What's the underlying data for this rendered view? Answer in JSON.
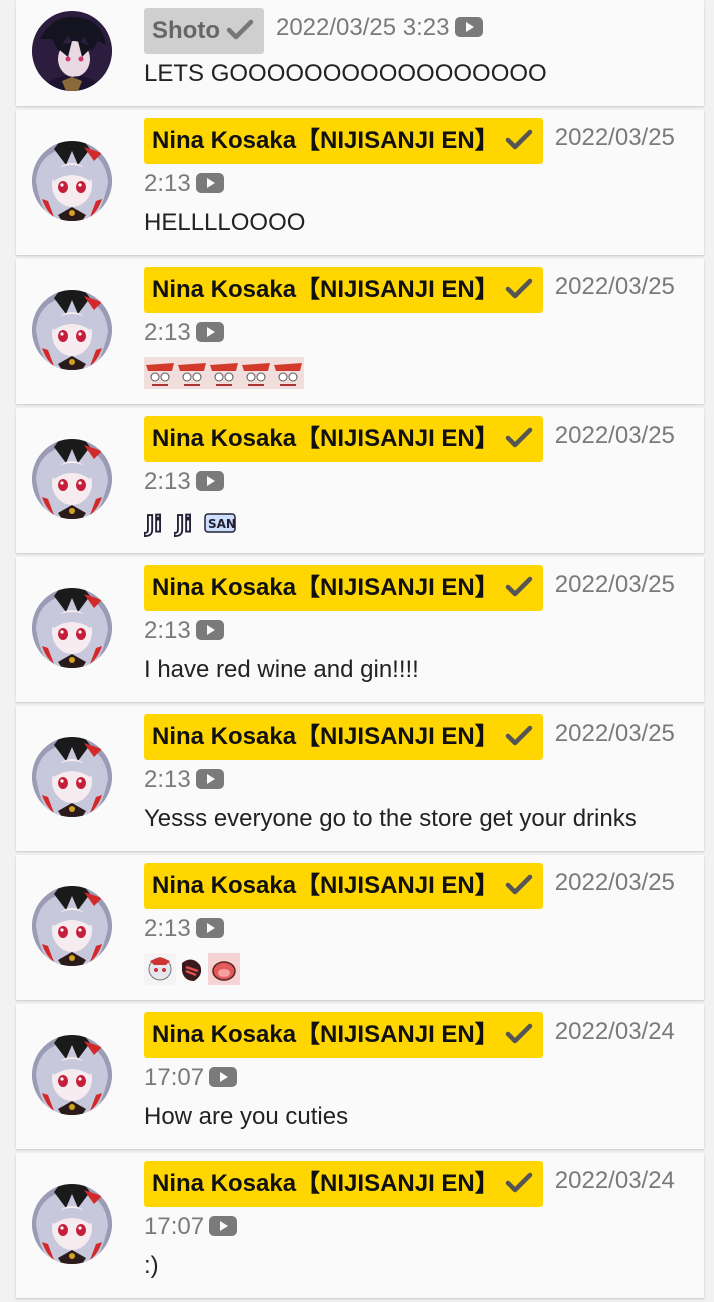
{
  "messages": [
    {
      "author": "Shoto",
      "badge": "grey",
      "date": "2022/03/25",
      "time": "3:23",
      "text": "LETS GOOOOOOOOOOOOOOOOO",
      "avatar": "shoto"
    },
    {
      "author": "Nina Kosaka【NIJISANJI EN】",
      "badge": "owner",
      "date": "2022/03/25",
      "time": "2:13",
      "text": "HELLLLOOOO",
      "avatar": "nina"
    },
    {
      "author": "Nina Kosaka【NIJISANJI EN】",
      "badge": "owner",
      "date": "2022/03/25",
      "time": "2:13",
      "text": "",
      "emotes": [
        "emote-face",
        "emote-face",
        "emote-face",
        "emote-face",
        "emote-face"
      ],
      "avatar": "nina"
    },
    {
      "author": "Nina Kosaka【NIJISANJI EN】",
      "badge": "owner",
      "date": "2022/03/25",
      "time": "2:13",
      "text": "",
      "emotes": [
        "emote-ji",
        "emote-ji",
        "emote-san"
      ],
      "avatar": "nina"
    },
    {
      "author": "Nina Kosaka【NIJISANJI EN】",
      "badge": "owner",
      "date": "2022/03/25",
      "time": "2:13",
      "text": "I have red wine and gin!!!!",
      "avatar": "nina"
    },
    {
      "author": "Nina Kosaka【NIJISANJI EN】",
      "badge": "owner",
      "date": "2022/03/25",
      "time": "2:13",
      "text": "Yesss everyone go to the store get your drinks",
      "avatar": "nina"
    },
    {
      "author": "Nina Kosaka【NIJISANJI EN】",
      "badge": "owner",
      "date": "2022/03/25",
      "time": "2:13",
      "text": "",
      "emotes": [
        "emote-chibi",
        "emote-hand",
        "emote-mouth"
      ],
      "avatar": "nina"
    },
    {
      "author": "Nina Kosaka【NIJISANJI EN】",
      "badge": "owner",
      "date": "2022/03/24",
      "time": "17:07",
      "text": "How are you cuties",
      "avatar": "nina"
    },
    {
      "author": "Nina Kosaka【NIJISANJI EN】",
      "badge": "owner",
      "date": "2022/03/24",
      "time": "17:07",
      "text": ":)",
      "avatar": "nina"
    }
  ],
  "icons": {
    "verified": "check-icon",
    "source": "youtube-icon"
  },
  "colors": {
    "owner_badge": "#ffd600",
    "grey_badge": "#cfcfcf",
    "timestamp": "#7a7a7a",
    "card": "#fafafa"
  }
}
